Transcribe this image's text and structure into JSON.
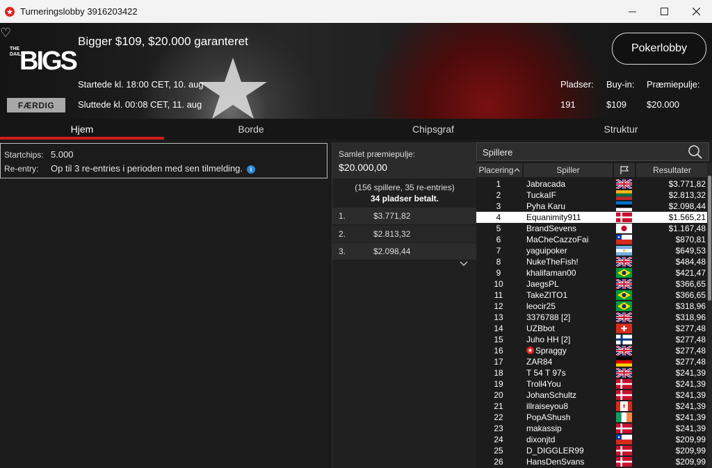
{
  "window": {
    "title": "Turneringslobby 3916203422",
    "minimize_icon": "minimize-icon",
    "maximize_icon": "maximize-icon",
    "close_icon": "close-icon"
  },
  "banner": {
    "favorite_icon": "heart-icon",
    "logo_small": "THE DAILY",
    "logo_big": "BIGS",
    "status": "FÆRDIG",
    "title": "Bigger $109, $20.000 garanteret",
    "started": "Startede kl. 18:00 CET, 10. aug",
    "ended": "Sluttede kl. 00:08 CET, 11. aug",
    "lobby_button": "Pokerlobby",
    "stats": {
      "seats_label": "Pladser:",
      "buyin_label": "Buy-in:",
      "prize_label": "Præmiepulje:",
      "seats": "191",
      "buyin": "$109",
      "prize": "$20.000"
    }
  },
  "tabs": [
    "Hjem",
    "Borde",
    "Chipsgraf",
    "Struktur"
  ],
  "active_tab": "Hjem",
  "info": {
    "startchips_label": "Startchips:",
    "startchips": "5.000",
    "reentry_label": "Re-entry:",
    "reentry": "Op til 3 re-entries i perioden med sen tilmelding.",
    "info_icon": "info-icon"
  },
  "prizepool": {
    "label": "Samlet præmiepulje:",
    "amount": "$20.000,00",
    "players_text": "(156 spillere, 35 re-entries)",
    "paid_text": "34 pladser betalt.",
    "rows": [
      {
        "place": "1.",
        "amount": "$3.771,82"
      },
      {
        "place": "2.",
        "amount": "$2.813,32"
      },
      {
        "place": "3.",
        "amount": "$2.098,44"
      }
    ],
    "expand_icon": "chevron-down-icon"
  },
  "players": {
    "search_placeholder": "Spillere",
    "search_icon": "search-icon",
    "col_place": "Placering",
    "col_player": "Spiller",
    "col_flag_icon": "flag-icon",
    "col_result": "Resultater",
    "highlight_place": "4",
    "rows": [
      {
        "place": "1",
        "name": "Jabracada",
        "flag": "uk",
        "result": "$3.771,82"
      },
      {
        "place": "2",
        "name": "TuckaIF",
        "flag": "lithuania",
        "result": "$2.813,32"
      },
      {
        "place": "3",
        "name": "Pyha Karu",
        "flag": "estonia",
        "result": "$2.098,44"
      },
      {
        "place": "4",
        "name": "Equanimity911",
        "flag": "denmark",
        "result": "$1.565,21"
      },
      {
        "place": "5",
        "name": "BrandSevens",
        "flag": "japan",
        "result": "$1.167,48"
      },
      {
        "place": "6",
        "name": "MaCheCazzoFai",
        "flag": "chile",
        "result": "$870,81"
      },
      {
        "place": "7",
        "name": "yaguipoker",
        "flag": "argentina",
        "result": "$649,53"
      },
      {
        "place": "8",
        "name": "NukeTheFish!",
        "flag": "uk",
        "result": "$484,48"
      },
      {
        "place": "9",
        "name": "khalifaman00",
        "flag": "brazil",
        "result": "$421,47"
      },
      {
        "place": "10",
        "name": "JaegsPL",
        "flag": "uk",
        "result": "$366,65"
      },
      {
        "place": "11",
        "name": "TakeZITO1",
        "flag": "brazil",
        "result": "$366,65"
      },
      {
        "place": "12",
        "name": "leocir25",
        "flag": "brazil",
        "result": "$318,96"
      },
      {
        "place": "13",
        "name": "3376788 [2]",
        "flag": "uk",
        "result": "$318,96"
      },
      {
        "place": "14",
        "name": "UZBbot",
        "flag": "switzerland",
        "result": "$277,48"
      },
      {
        "place": "15",
        "name": "Juho HH [2]",
        "flag": "finland",
        "result": "$277,48"
      },
      {
        "place": "16",
        "name": "Spraggy",
        "flag": "uk",
        "result": "$277,48",
        "badge_icon": "pokerstars-star-icon"
      },
      {
        "place": "17",
        "name": "ZAR84",
        "flag": "germany",
        "result": "$277,48"
      },
      {
        "place": "18",
        "name": "T 54 T 97s",
        "flag": "uk",
        "result": "$241,39"
      },
      {
        "place": "19",
        "name": "Troll4You",
        "flag": "denmark",
        "result": "$241,39"
      },
      {
        "place": "20",
        "name": "JohanSchultz",
        "flag": "denmark",
        "result": "$241,39"
      },
      {
        "place": "21",
        "name": "illraiseyou8",
        "flag": "canada",
        "result": "$241,39"
      },
      {
        "place": "22",
        "name": "PopAShush",
        "flag": "ireland",
        "result": "$241,39"
      },
      {
        "place": "23",
        "name": "makassip",
        "flag": "denmark",
        "result": "$241,39"
      },
      {
        "place": "24",
        "name": "dixonjtd",
        "flag": "chile",
        "result": "$209,99"
      },
      {
        "place": "25",
        "name": "D_DIGGLER99",
        "flag": "denmark",
        "result": "$209,99"
      },
      {
        "place": "26",
        "name": "HansDenSvans",
        "flag": "denmark",
        "result": "$209,99"
      }
    ]
  }
}
